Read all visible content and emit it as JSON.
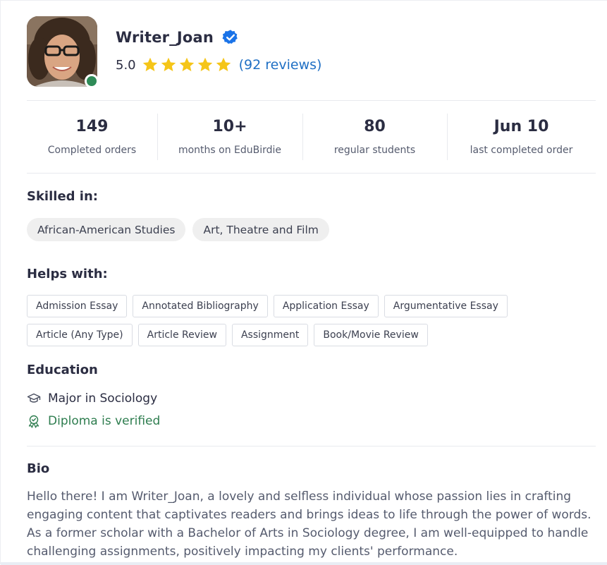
{
  "profile": {
    "name": "Writer_Joan",
    "rating": "5.0",
    "star_count": 5,
    "reviews_label": "(92 reviews)",
    "online": true,
    "verified_icon": "verified-badge-icon"
  },
  "stats": [
    {
      "value": "149",
      "label": "Completed orders"
    },
    {
      "value": "10+",
      "label": "months on EduBirdie"
    },
    {
      "value": "80",
      "label": "regular students"
    },
    {
      "value": "Jun 10",
      "label": "last completed order"
    }
  ],
  "skilled": {
    "title": "Skilled in:",
    "items": [
      "African-American Studies",
      "Art, Theatre and Film"
    ]
  },
  "helps": {
    "title": "Helps with:",
    "items": [
      "Admission Essay",
      "Annotated Bibliography",
      "Application Essay",
      "Argumentative Essay",
      "Article (Any Type)",
      "Article Review",
      "Assignment",
      "Book/Movie Review"
    ]
  },
  "education": {
    "title": "Education",
    "major": "Major in Sociology",
    "diploma": "Diploma is verified"
  },
  "bio": {
    "title": "Bio",
    "text": "Hello there! I am Writer_Joan, a lovely and selfless individual whose passion lies in crafting engaging content that captivates readers and brings ideas to life through the power of words. As a former scholar with a Bachelor of Arts in Sociology degree, I am well-equipped to handle challenging assignments, positively impacting my clients' performance."
  },
  "colors": {
    "star": "#f5c518",
    "link": "#1f6fc4",
    "verified_badge": "#1a73e8",
    "online": "#2e8b57",
    "diploma_green": "#2e7d4f"
  }
}
